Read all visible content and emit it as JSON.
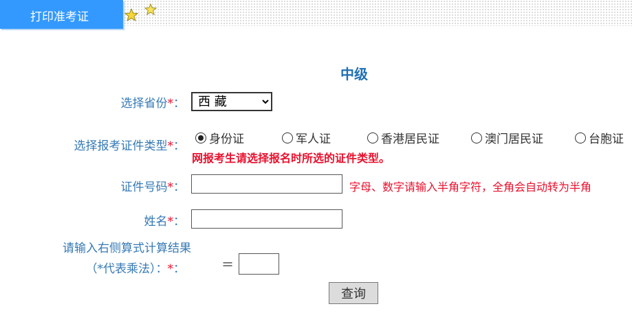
{
  "header": {
    "tab_label": "打印准考证"
  },
  "form": {
    "title": "中级",
    "province_label": "选择省份",
    "province_value": "西 藏",
    "required_mark": "*",
    "colon": "：",
    "id_type_label": "选择报考证件类型",
    "id_types": [
      {
        "label": "身份证",
        "selected": true
      },
      {
        "label": "军人证",
        "selected": false
      },
      {
        "label": "香港居民证",
        "selected": false
      },
      {
        "label": "澳门居民证",
        "selected": false
      },
      {
        "label": "台胞证",
        "selected": false
      }
    ],
    "id_type_warning": "网报考生请选择报名时所选的证件类型。",
    "id_number_label": "证件号码",
    "id_number_value": "",
    "id_number_hint": "字母、数字请输入半角字符，全角会自动转为半角",
    "name_label": "姓名",
    "name_value": "",
    "captcha_label_line1": "请输入右侧算式计算结果",
    "captcha_label_line2": "（*代表乘法）：",
    "captcha_equals": "＝",
    "captcha_value": "",
    "submit_label": "查询"
  }
}
